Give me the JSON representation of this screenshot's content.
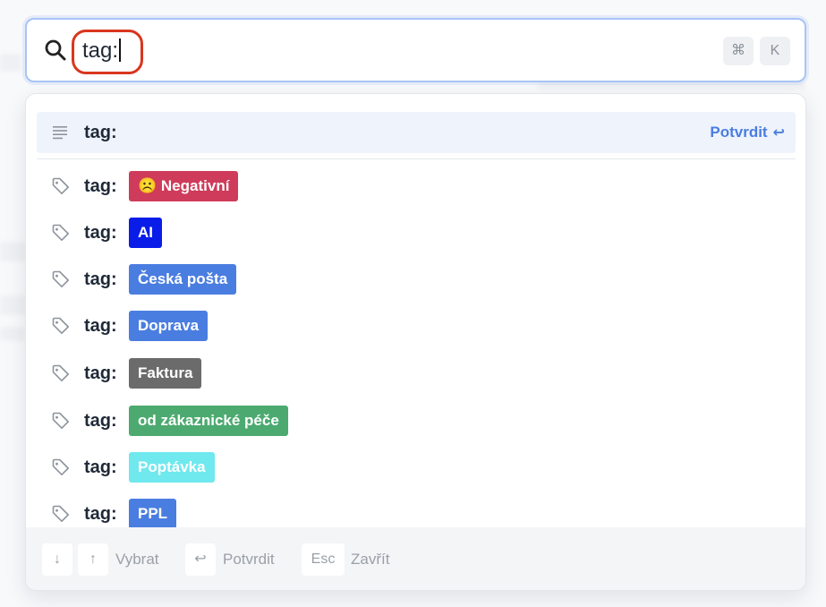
{
  "search": {
    "value": "tag:",
    "shortcut_keys": [
      "⌘",
      "K"
    ]
  },
  "confirm_row": {
    "text": "tag:",
    "action_label": "Potvrdit",
    "action_glyph": "↩"
  },
  "tag_prefix": "tag:",
  "tags": [
    {
      "label": "Negativní",
      "emoji": "☹️",
      "color": "#cf3b5a",
      "text_color": "#ffffff"
    },
    {
      "label": "AI",
      "emoji": "",
      "color": "#0a1de8",
      "text_color": "#ffffff"
    },
    {
      "label": "Česká pošta",
      "emoji": "",
      "color": "#4a7de0",
      "text_color": "#ffffff"
    },
    {
      "label": "Doprava",
      "emoji": "",
      "color": "#4a7de0",
      "text_color": "#ffffff"
    },
    {
      "label": "Faktura",
      "emoji": "",
      "color": "#6b6b6b",
      "text_color": "#ffffff"
    },
    {
      "label": "od zákaznické péče",
      "emoji": "",
      "color": "#4caa70",
      "text_color": "#ffffff"
    },
    {
      "label": "Poptávka",
      "emoji": "",
      "color": "#6fe8ee",
      "text_color": "#ffffff"
    },
    {
      "label": "PPL",
      "emoji": "",
      "color": "#4a7de0",
      "text_color": "#ffffff"
    }
  ],
  "footer": {
    "down_key": "↓",
    "up_key": "↑",
    "select_label": "Vybrat",
    "enter_key": "↩",
    "confirm_label": "Potvrdit",
    "esc_key": "Esc",
    "close_label": "Zavřít"
  },
  "colors": {
    "accent": "#4a7de0",
    "annotation": "#d9361e"
  },
  "icons": {
    "search": "search-icon",
    "confirm": "lines-icon",
    "tag": "tag-icon"
  }
}
